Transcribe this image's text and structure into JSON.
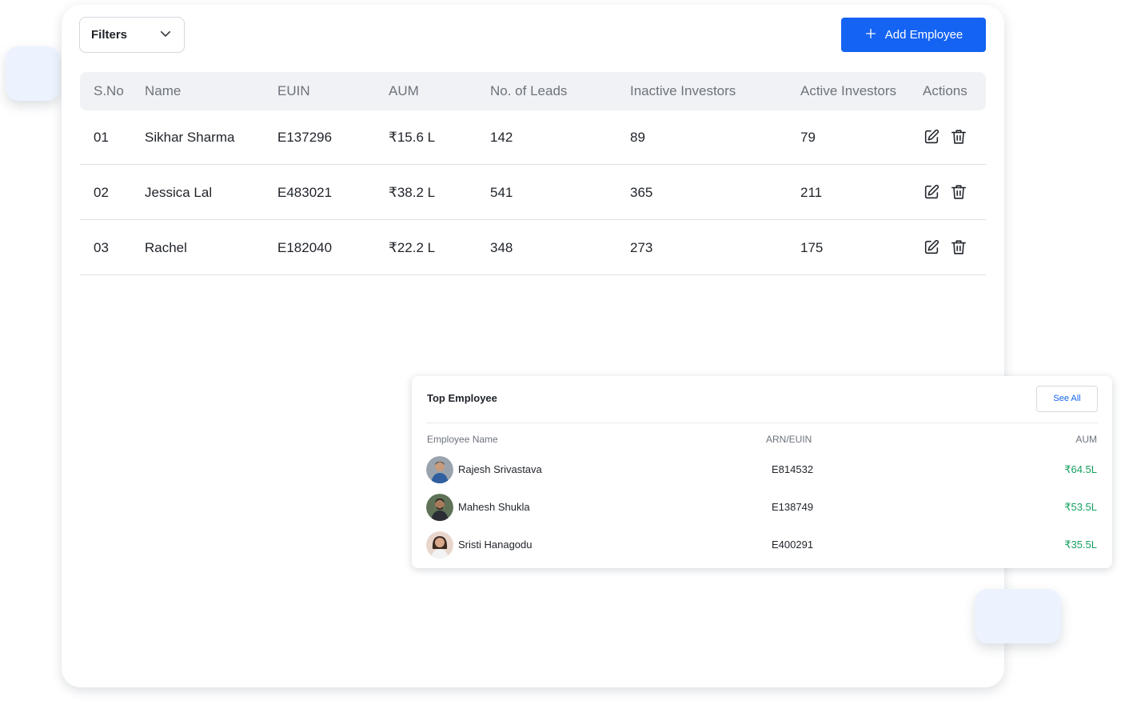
{
  "toolbar": {
    "filters_label": "Filters",
    "add_button_label": "Add Employee"
  },
  "table": {
    "columns": [
      "S.No",
      "Name",
      "EUIN",
      "AUM",
      "No. of Leads",
      "Inactive Investors",
      "Active Investors",
      "Actions"
    ],
    "rows": [
      {
        "sno": "01",
        "name": "Sikhar Sharma",
        "euin": "E137296",
        "aum": "₹15.6 L",
        "leads": "142",
        "inactive": "89",
        "active": "79"
      },
      {
        "sno": "02",
        "name": "Jessica Lal",
        "euin": "E483021",
        "aum": "₹38.2 L",
        "leads": "541",
        "inactive": "365",
        "active": "211"
      },
      {
        "sno": "03",
        "name": "Rachel",
        "euin": "E182040",
        "aum": "₹22.2 L",
        "leads": "348",
        "inactive": "273",
        "active": "175"
      }
    ]
  },
  "top_employee": {
    "title": "Top Employee",
    "see_all_label": "See All",
    "columns": [
      "Employee Name",
      "ARN/EUIN",
      "AUM"
    ],
    "rows": [
      {
        "name": "Rajesh Srivastava",
        "arn": "E814532",
        "aum": "₹64.5L"
      },
      {
        "name": "Mahesh Shukla",
        "arn": "E138749",
        "aum": "₹53.5L"
      },
      {
        "name": "Sristi Hanagodu",
        "arn": "E400291",
        "aum": "₹35.5L"
      }
    ]
  },
  "colors": {
    "primary": "#1463f3",
    "aum_positive": "#17a060",
    "header_bg": "#f1f2f5",
    "decor_bg": "#ecf3fe"
  },
  "icons": {
    "filter_toggle": "chevron-down-icon",
    "add": "plus-icon",
    "edit": "edit-icon",
    "delete": "trash-icon"
  }
}
